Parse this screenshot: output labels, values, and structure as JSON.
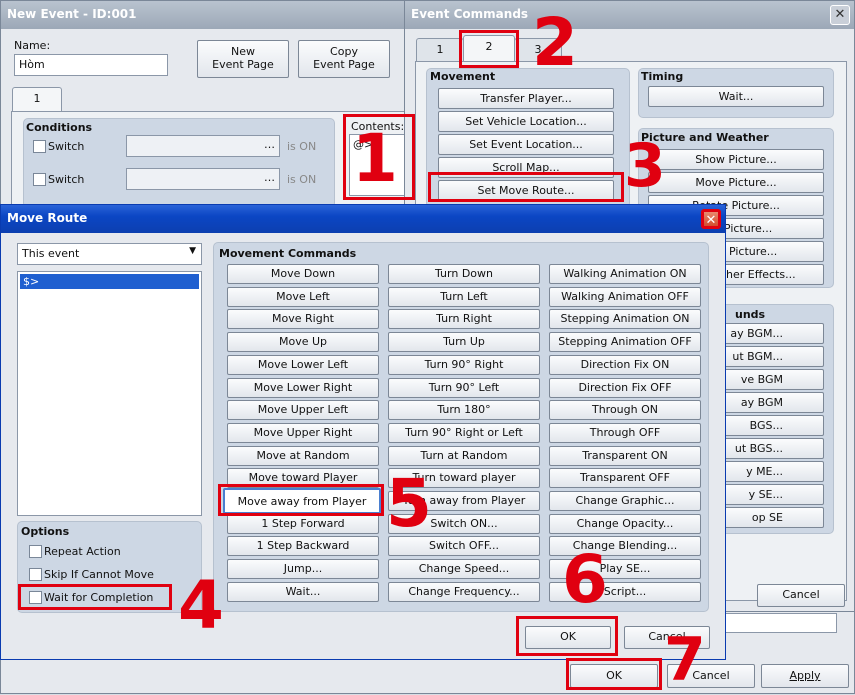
{
  "new_event": {
    "title": "New Event - ID:001",
    "name_label": "Name:",
    "name_value": "Hòm",
    "new_page": "New\nEvent Page",
    "copy_page": "Copy\nEvent Page",
    "tab": "1",
    "conditions": "Conditions",
    "switch": "Switch",
    "is_on": "is ON",
    "contents": "Contents:",
    "content_line": "@>",
    "ok": "OK",
    "cancel": "Cancel",
    "apply": "Apply"
  },
  "event_commands": {
    "title": "Event Commands",
    "tabs": [
      "1",
      "2",
      "3"
    ],
    "movement": "Movement",
    "movement_buttons": [
      "Transfer Player...",
      "Set Vehicle Location...",
      "Set Event Location...",
      "Scroll Map...",
      "Set Move Route..."
    ],
    "timing": "Timing",
    "wait": "Wait...",
    "picture_weather": "Picture and Weather",
    "picture_buttons": [
      "Show Picture...",
      "Move Picture...",
      "Rotate Picture...",
      "Tint Picture...",
      "Erase Picture...",
      "Set Weather Effects..."
    ],
    "sounds_partial": "unds",
    "sound_buttons": [
      "ay BGM...",
      "ut BGM...",
      "ve BGM",
      "ay BGM",
      "BGS...",
      "ut BGS...",
      "y ME...",
      "y SE...",
      "op SE"
    ],
    "cancel": "Cancel"
  },
  "move_route": {
    "title": "Move Route",
    "target": "This event",
    "list_item": "$>",
    "movement_commands": "Movement Commands",
    "col1": [
      "Move Down",
      "Move Left",
      "Move Right",
      "Move Up",
      "Move Lower Left",
      "Move Lower Right",
      "Move Upper Left",
      "Move Upper Right",
      "Move at Random",
      "Move toward Player",
      "Move away from Player",
      "1 Step Forward",
      "1 Step Backward",
      "Jump...",
      "Wait..."
    ],
    "col2": [
      "Turn Down",
      "Turn Left",
      "Turn Right",
      "Turn Up",
      "Turn 90° Right",
      "Turn 90° Left",
      "Turn 180°",
      "Turn 90° Right or Left",
      "Turn at Random",
      "Turn toward player",
      "Turn away from Player",
      "Switch ON...",
      "Switch OFF...",
      "Change Speed...",
      "Change Frequency..."
    ],
    "col3": [
      "Walking Animation ON",
      "Walking Animation OFF",
      "Stepping Animation ON",
      "Stepping Animation OFF",
      "Direction Fix ON",
      "Direction Fix OFF",
      "Through ON",
      "Through OFF",
      "Transparent ON",
      "Transparent OFF",
      "Change Graphic...",
      "Change Opacity...",
      "Change Blending...",
      "Play SE...",
      "Script..."
    ],
    "options": "Options",
    "opts": [
      "Repeat Action",
      "Skip If Cannot Move",
      "Wait for Completion"
    ],
    "ok": "OK",
    "cancel": "Cancel"
  },
  "annotations": [
    "1",
    "2",
    "3",
    "4",
    "5",
    "6",
    "7"
  ]
}
